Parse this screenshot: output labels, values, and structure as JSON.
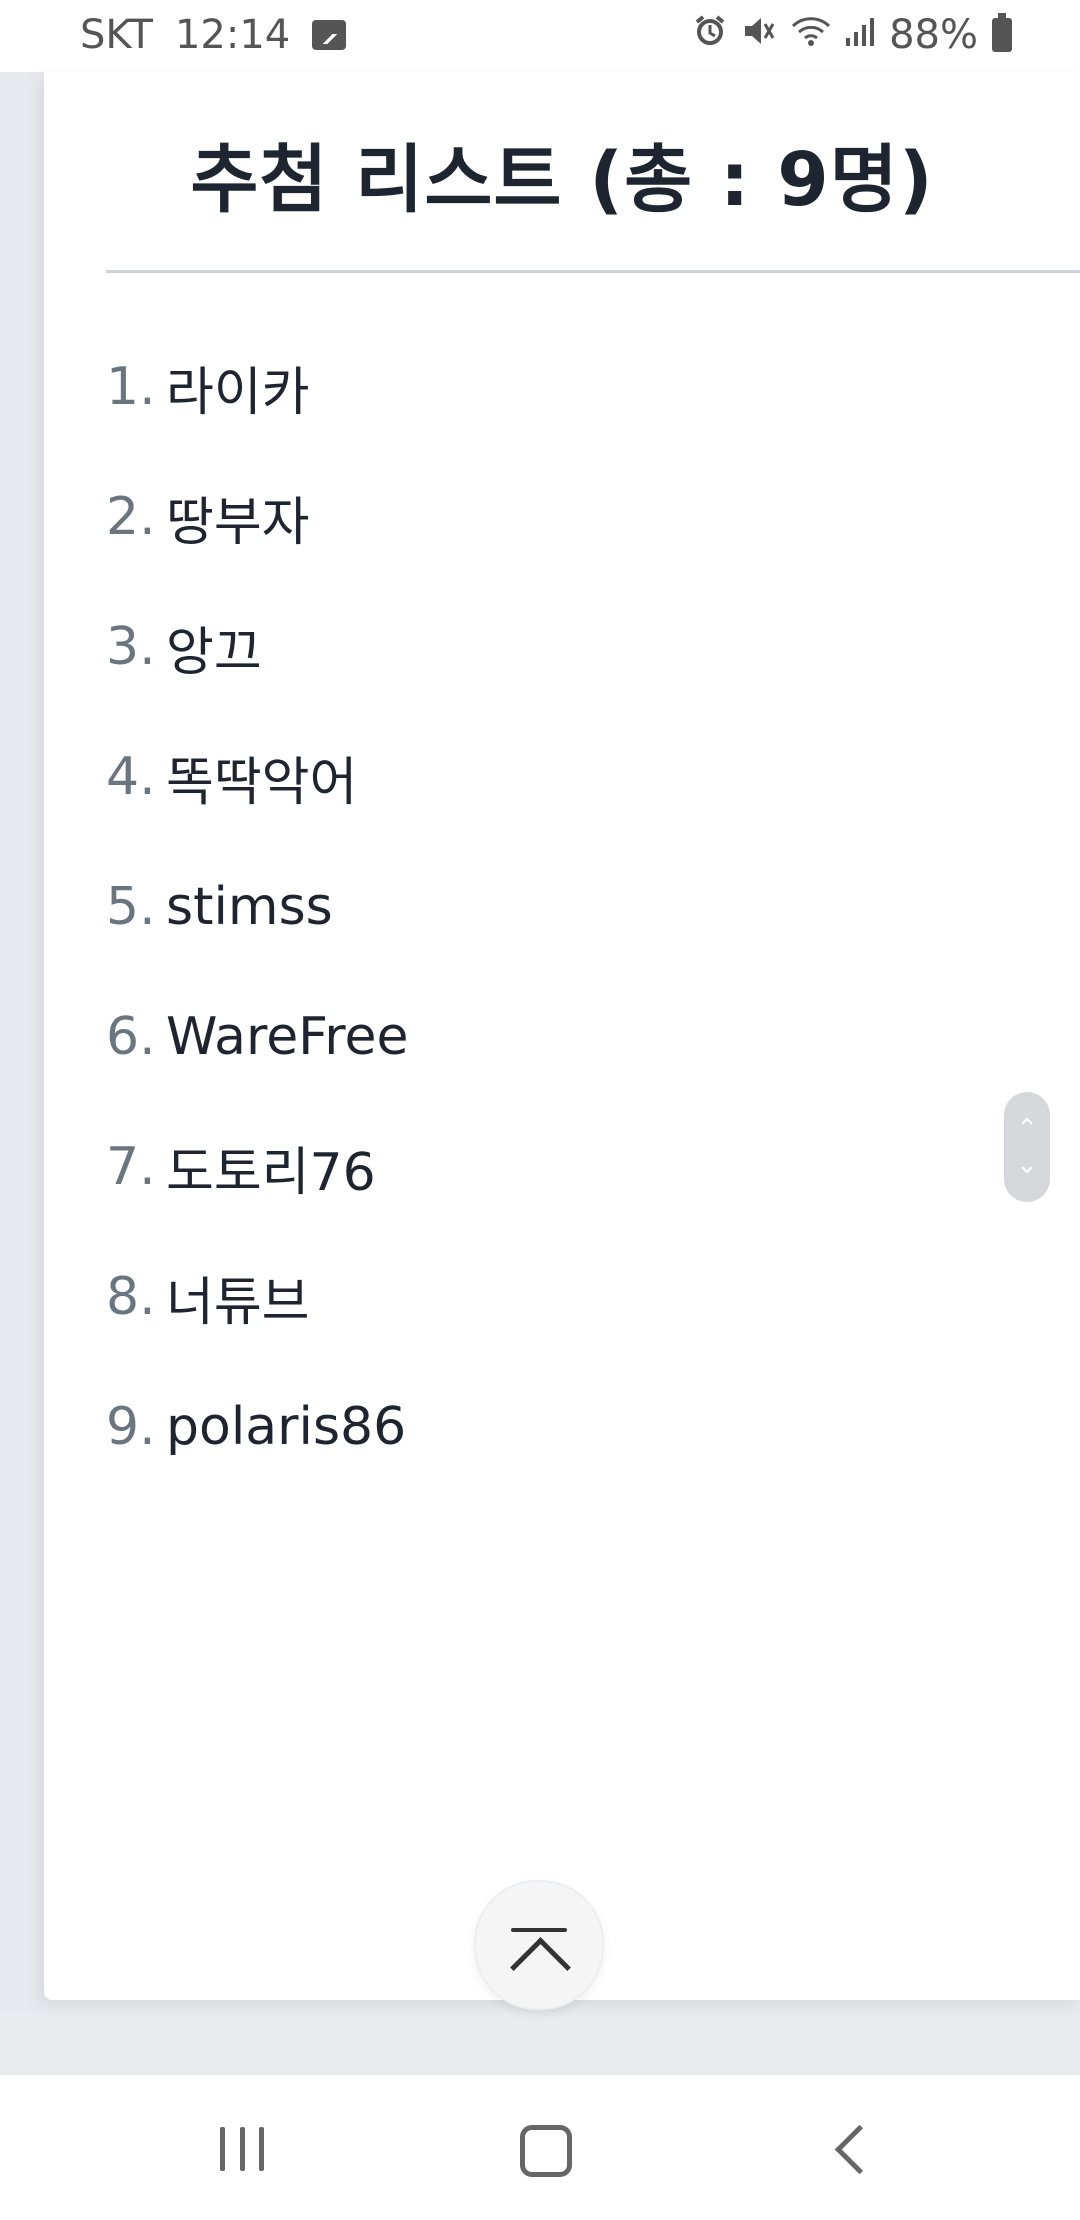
{
  "status_bar": {
    "carrier": "SKT",
    "time": "12:14",
    "battery": "88%",
    "icons": [
      "image-icon",
      "alarm-icon",
      "mute-icon",
      "wifi-icon",
      "signal-icon",
      "battery-icon"
    ]
  },
  "page": {
    "title": "추첨 리스트 (총 : 9명)",
    "list": [
      {
        "num": "1.",
        "name": "라이카"
      },
      {
        "num": "2.",
        "name": "땅부자"
      },
      {
        "num": "3.",
        "name": "앙끄"
      },
      {
        "num": "4.",
        "name": "똑딱악어"
      },
      {
        "num": "5.",
        "name": "stimss"
      },
      {
        "num": "6.",
        "name": "WareFree"
      },
      {
        "num": "7.",
        "name": "도토리76"
      },
      {
        "num": "8.",
        "name": "너튜브"
      },
      {
        "num": "9.",
        "name": "polaris86"
      }
    ]
  },
  "controls": {
    "scroll_widget_icons": [
      "chevron-up-icon",
      "chevron-down-icon"
    ],
    "top_button_icon": "scroll-to-top-icon"
  },
  "nav_bar": {
    "icons": [
      "recents-icon",
      "home-icon",
      "back-icon"
    ]
  },
  "colors": {
    "title": "#1e2430",
    "number": "#6b7580",
    "divider": "#cfd2d6",
    "background": "#e9ebef"
  }
}
